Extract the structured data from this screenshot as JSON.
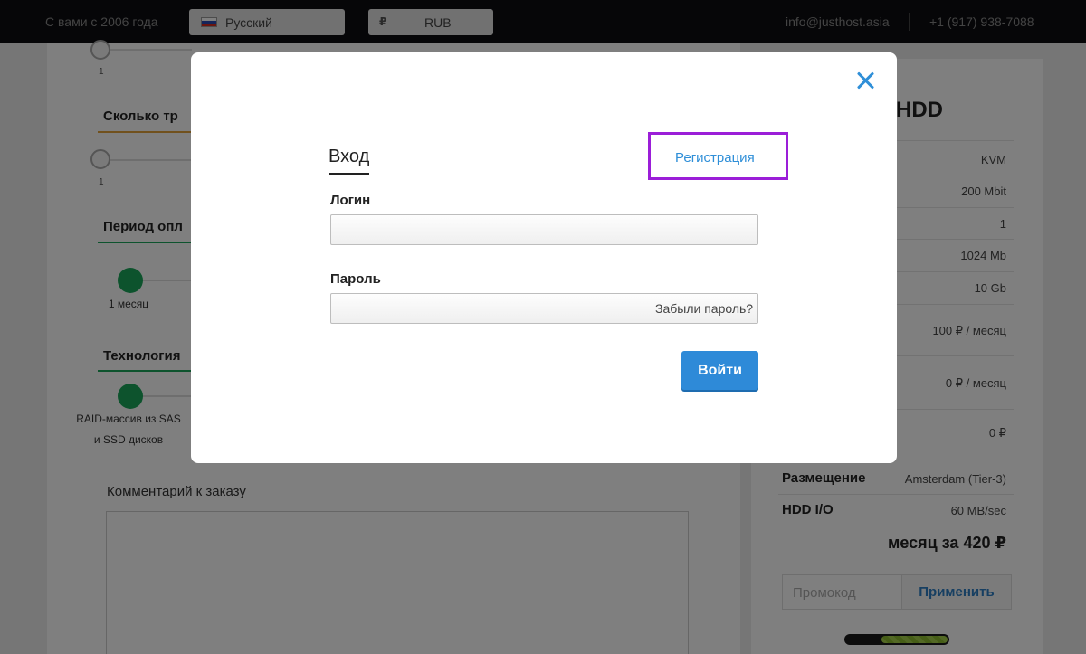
{
  "topbar": {
    "since": "С вами с 2006 года",
    "language": "Русский",
    "currency_symbol": "₽",
    "currency": "RUB",
    "email": "info@justhost.asia",
    "phone": "+1 (917) 938-7088"
  },
  "config": {
    "slider1_value": "1",
    "section2_title": "Сколько тр",
    "slider2_value": "1",
    "section3_title": "Период опл",
    "period_option": "1 месяц",
    "section4_title": "Технология",
    "tech_option_line1": "RAID-массив из SAS",
    "tech_option_line2": "и SSD дисков",
    "comment_title": "Комментарий к заказу"
  },
  "summary": {
    "title_fragment": "а HDD",
    "rows": [
      "KVM",
      "200 Mbit",
      "1",
      "1024 Mb",
      "10 Gb",
      "100 ₽ / месяц",
      "0 ₽ / месяц",
      "0 ₽"
    ],
    "placement_label": "Размещение",
    "placement_value": "Amsterdam (Tier-3)",
    "io_label": "HDD I/O",
    "io_value": "60 MB/sec",
    "total": "месяц за 420 ₽",
    "promo_placeholder": "Промокод",
    "promo_button": "Применить",
    "progress_fraction": 0.65
  },
  "modal": {
    "tab_login": "Вход",
    "tab_register": "Регистрация",
    "login_label": "Логин",
    "login_value": "",
    "password_label": "Пароль",
    "forgot_password": "Забыли пароль?",
    "submit": "Войти"
  },
  "colors": {
    "accent_blue": "#2e8ad8",
    "highlight_purple": "#9b1ed8",
    "green": "#1aa75a",
    "section_line_orange": "#e3a33b",
    "section_line_green": "#1aa75a"
  }
}
